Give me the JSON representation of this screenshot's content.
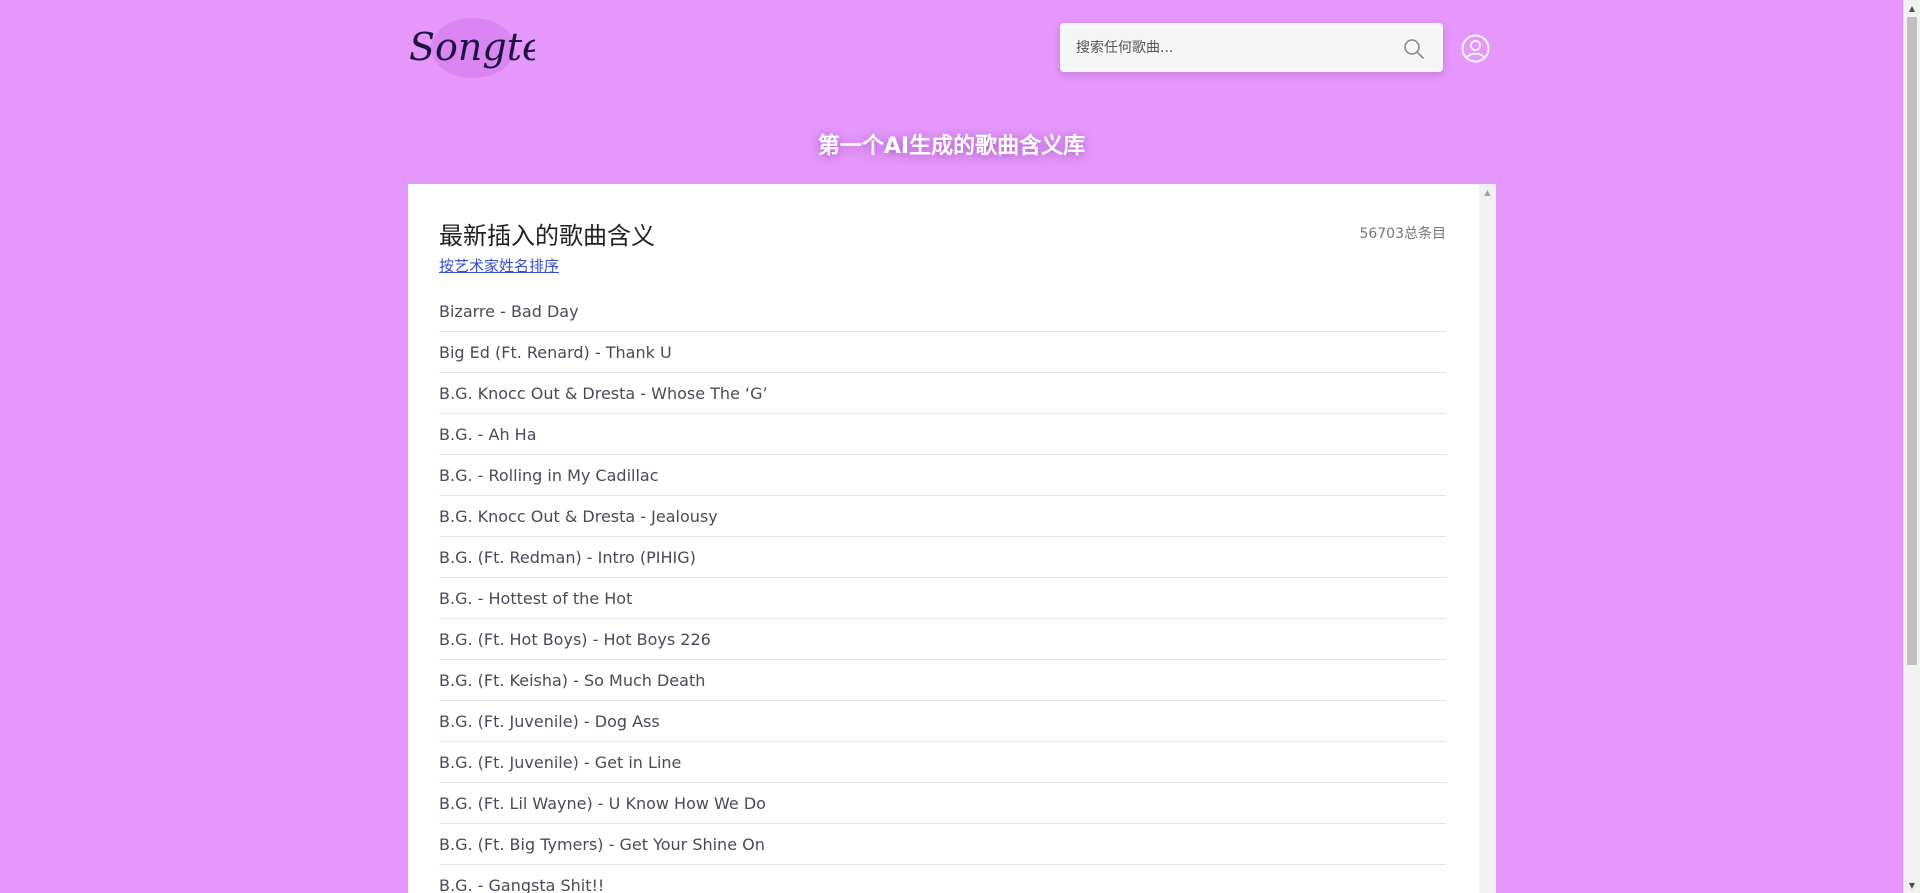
{
  "header": {
    "logo_text": "Songtell",
    "search": {
      "placeholder": "搜索任何歌曲...",
      "icon": "search-icon"
    },
    "user_icon": "user-account-icon"
  },
  "tagline": "第一个AI生成的歌曲含义库",
  "panel": {
    "title": "最新插入的歌曲含义",
    "total_count": "56703总条目",
    "sort_link": "按艺术家姓名排序"
  },
  "songs": [
    "Bizarre - Bad Day",
    "Big Ed (Ft. Renard) - Thank U",
    "B.G. Knocc Out & Dresta - Whose The ‘G’",
    "B.G. - Ah Ha",
    "B.G. - Rolling in My Cadillac",
    "B.G. Knocc Out & Dresta - Jealousy",
    "B.G. (Ft. Redman) - Intro (PIHIG)",
    "B.G. - Hottest of the Hot",
    "B.G. (Ft. Hot Boys) - Hot Boys 226",
    "B.G. (Ft. Keisha) - So Much Death",
    "B.G. (Ft. Juvenile) - Dog Ass",
    "B.G. (Ft. Juvenile) - Get in Line",
    "B.G. (Ft. Lil Wayne) - U Know How We Do",
    "B.G. (Ft. Big Tymers) - Get Your Shine On",
    "B.G. - Gangsta Shit!!"
  ],
  "colors": {
    "background": "#e597fb",
    "panel": "#ffffff",
    "link": "#3a4fc7",
    "logo_ink": "#1c1440"
  }
}
